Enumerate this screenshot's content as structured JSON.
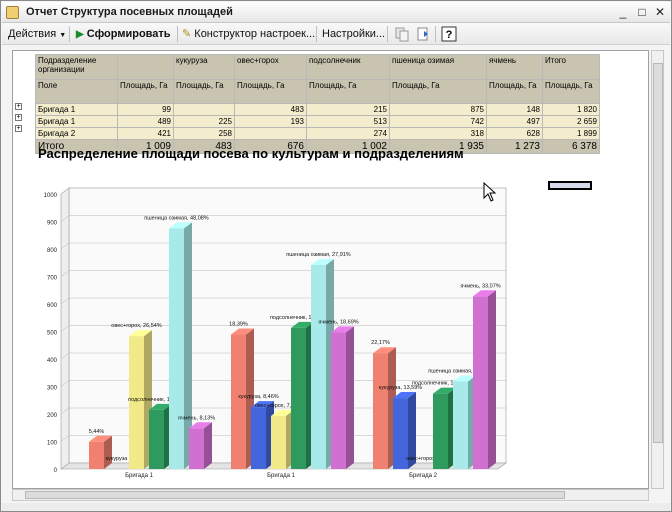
{
  "window": {
    "title": "Отчет  Структура посевных площадей",
    "controls": [
      "_",
      "□",
      "✕"
    ]
  },
  "toolbar": {
    "actions_label": "Действия",
    "generate_label": "Сформировать",
    "constructor_label": "Конструктор настроек...",
    "settings_label": "Настройки..."
  },
  "table": {
    "header_row1": [
      "Подразделение организации",
      "",
      "кукуруза",
      "овес+горох",
      "подсолнечник",
      "пшеница озимая",
      "ячмень",
      "Итого"
    ],
    "header_row2": [
      "Поле",
      "Площадь, Га",
      "Площадь, Га",
      "Площадь, Га",
      "Площадь, Га",
      "Площадь, Га",
      "Площадь, Га",
      "Площадь, Га"
    ],
    "rows": [
      [
        "Бригада 1",
        "99",
        "",
        "483",
        "215",
        "875",
        "148",
        "1 820"
      ],
      [
        "Бригада 1",
        "489",
        "225",
        "193",
        "513",
        "742",
        "497",
        "2 659"
      ],
      [
        "Бригада 2",
        "421",
        "258",
        "",
        "274",
        "318",
        "628",
        "1 899"
      ]
    ],
    "total": [
      "Итого",
      "1 009",
      "483",
      "676",
      "1 002",
      "1 935",
      "1 273",
      "6 378"
    ]
  },
  "colors": {
    "s1": "#f08070",
    "kukuruza": "#4466dd",
    "oves": "#f2ea88",
    "podsolnechnik": "#2e9a5e",
    "pshenitsa": "#a8eaea",
    "yachmen": "#d070d0"
  },
  "chart_data": {
    "type": "bar",
    "title": "Распределение площади посева по культурам и подразделениям",
    "categories": [
      "Бригада 1",
      "Бригада 1",
      "Бригада 2"
    ],
    "ylim": [
      0,
      1000
    ],
    "yticks": [
      "0",
      "100",
      "200",
      "300",
      "400",
      "500",
      "600",
      "700",
      "800",
      "900",
      "1000"
    ],
    "series": [
      {
        "values": [
          99,
          489,
          421
        ],
        "labels": [
          "5,44%",
          "18,39%",
          "22,17%"
        ]
      },
      {
        "values": [
          0,
          225,
          258
        ],
        "labels": [
          "кукуруза",
          "кукуруза, 8,46%",
          "кукуруза, 13,59%"
        ]
      },
      {
        "values": [
          483,
          193,
          0
        ],
        "labels": [
          "овес+горох, 26,54%",
          "овес+горох, 7,26%",
          "овес+горох"
        ]
      },
      {
        "values": [
          215,
          513,
          274
        ],
        "labels": [
          "подсолнечник, 11,81%",
          "подсолнечник, 19,29%",
          "подсолнечник, 14,43%"
        ]
      },
      {
        "values": [
          875,
          742,
          318
        ],
        "labels": [
          "пшеница озимая, 48,08%",
          "пшеница озимая, 27,91%",
          "пшеница озимая, 16,75%"
        ]
      },
      {
        "values": [
          148,
          497,
          628
        ],
        "labels": [
          "ячмень, 8,13%",
          "ячмень, 18,69%",
          "ячмень, 33,07%"
        ]
      }
    ]
  }
}
